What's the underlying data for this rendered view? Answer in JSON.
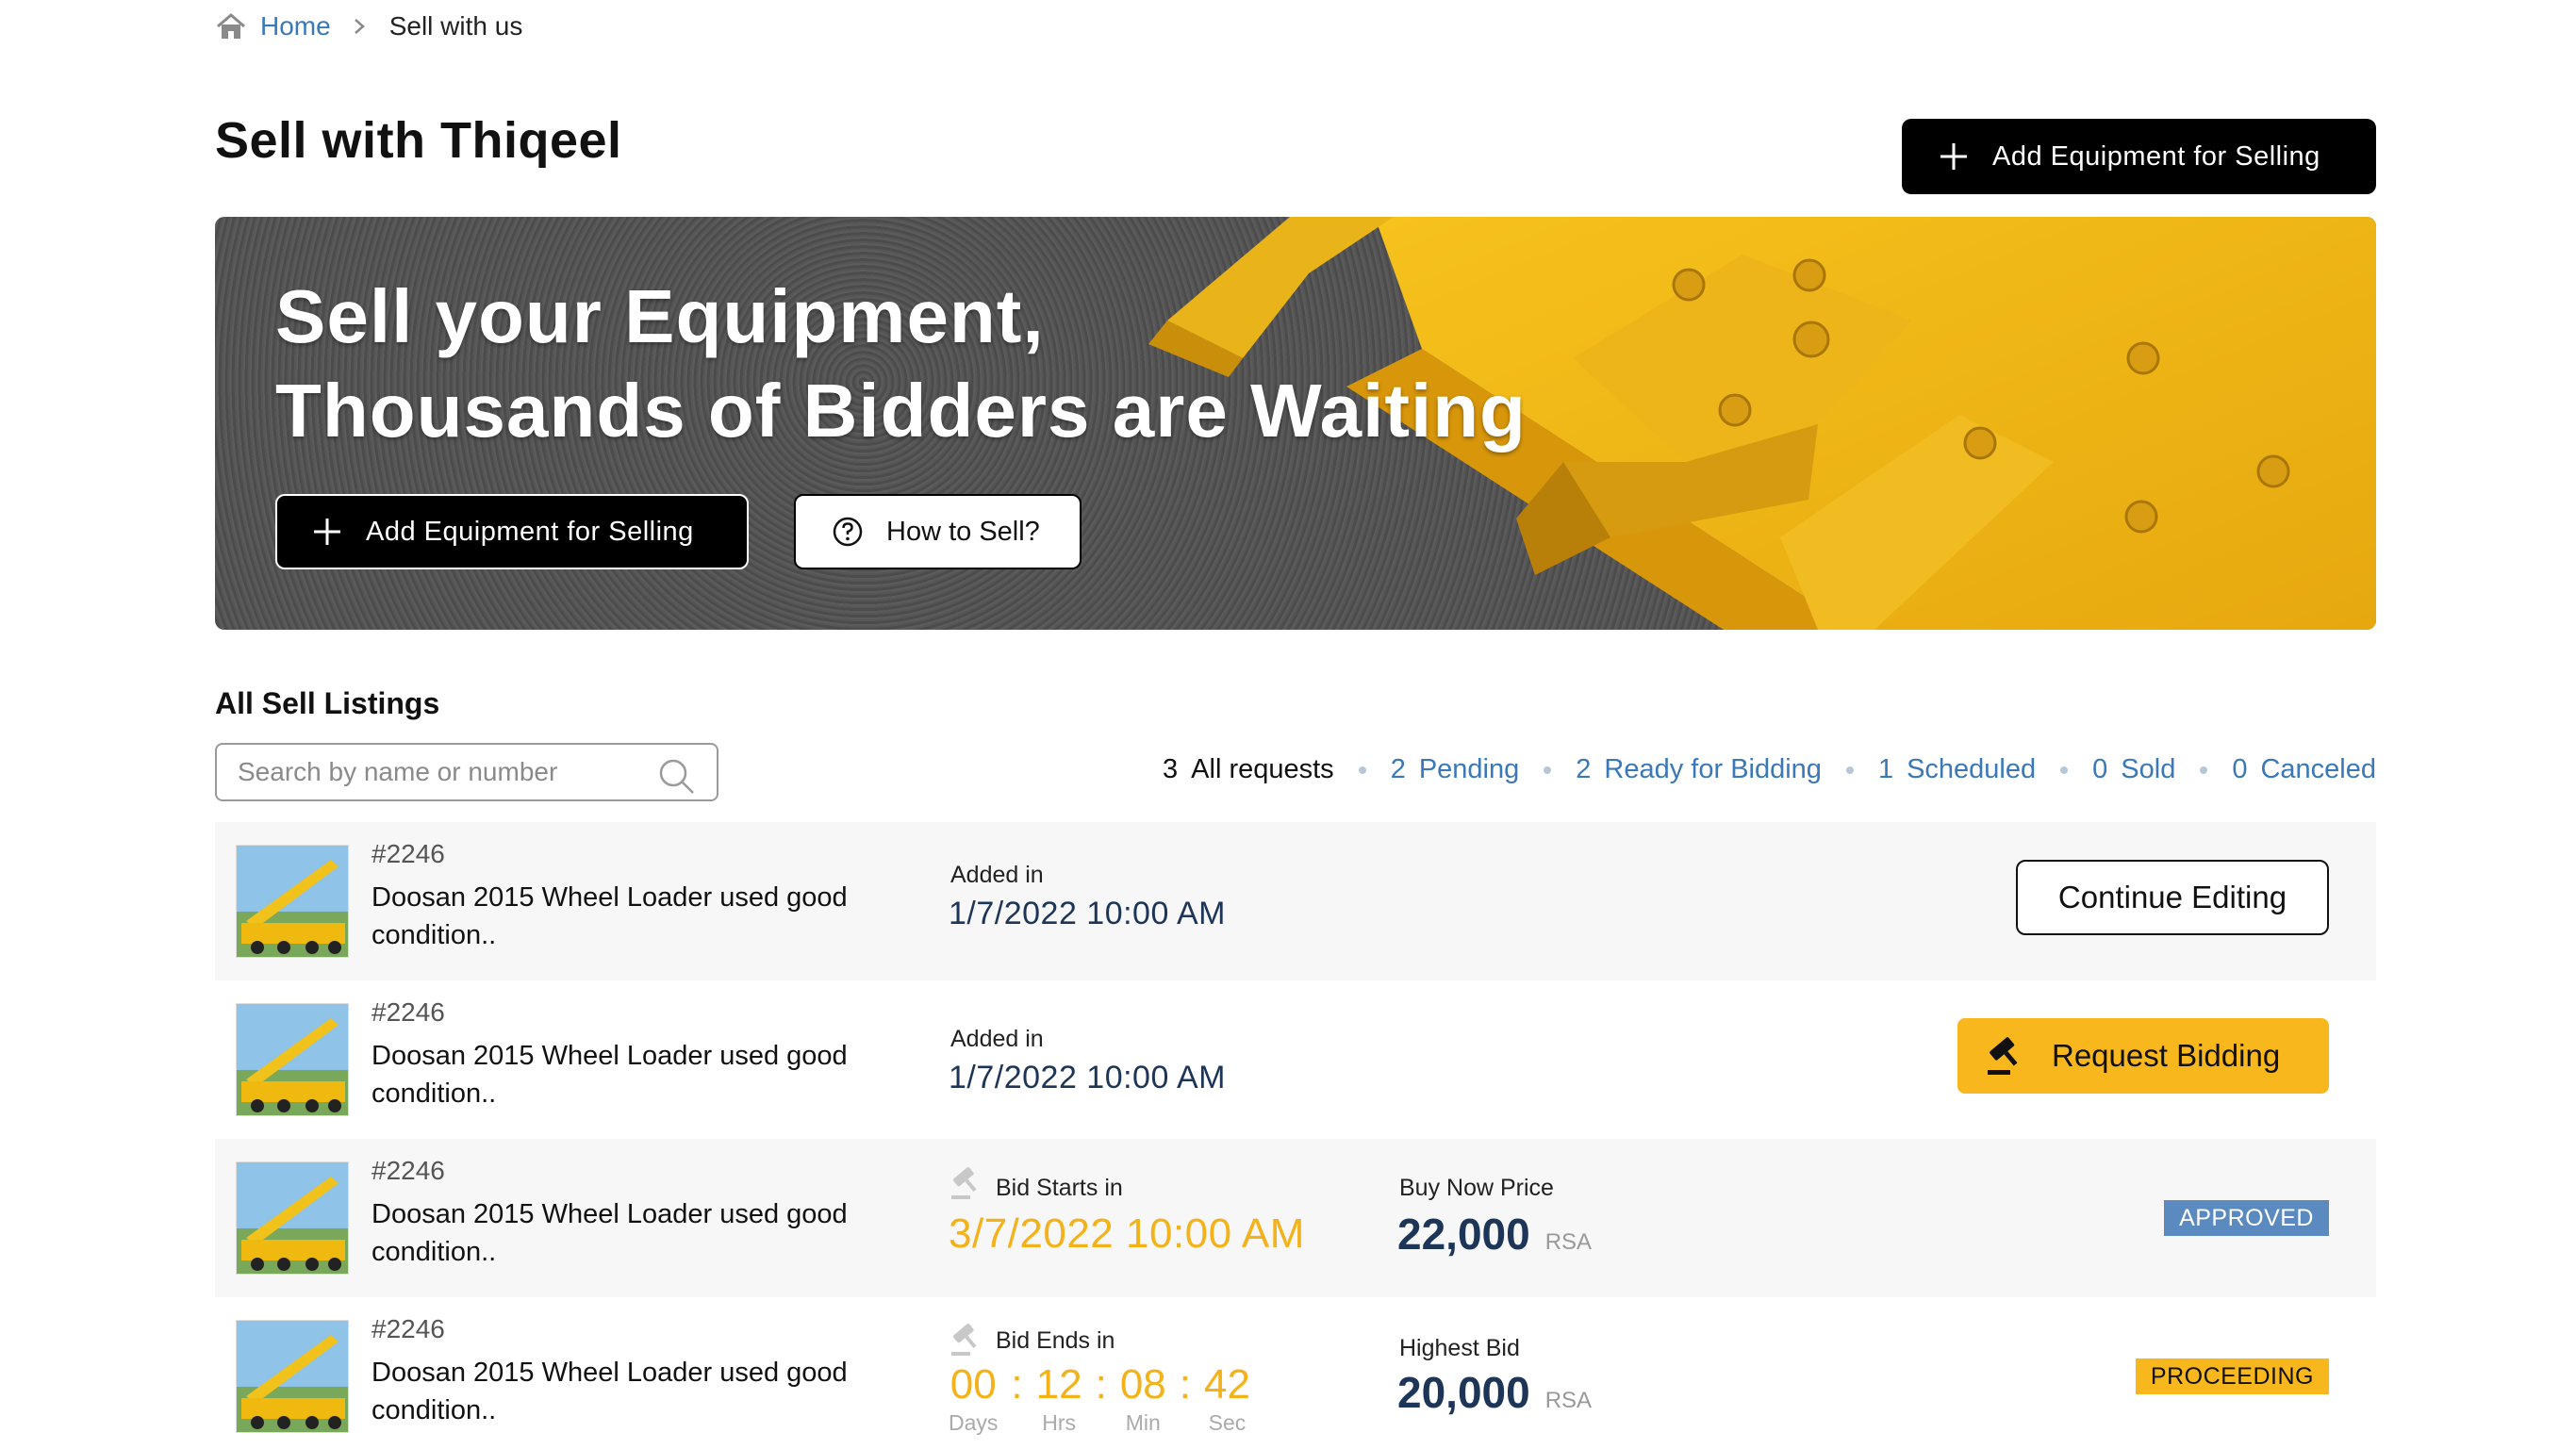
{
  "breadcrumb": {
    "home": "Home",
    "current": "Sell with us"
  },
  "page": {
    "title": "Sell with Thiqeel",
    "add_button": "Add Equipment for Selling"
  },
  "hero": {
    "title_line1": "Sell your Equipment,",
    "title_line2": "Thousands of Bidders are Waiting",
    "add_button": "Add Equipment for Selling",
    "how_button": "How to Sell?"
  },
  "listings": {
    "title": "All Sell Listings",
    "search_placeholder": "Search by name or number",
    "filters": [
      {
        "count": "3",
        "label": "All requests"
      },
      {
        "count": "2",
        "label": "Pending"
      },
      {
        "count": "2",
        "label": "Ready for Bidding"
      },
      {
        "count": "1",
        "label": "Scheduled"
      },
      {
        "count": "0",
        "label": "Sold"
      },
      {
        "count": "0",
        "label": "Canceled"
      }
    ],
    "rows": [
      {
        "id": "#2246",
        "name": "Doosan 2015 Wheel Loader used good condition..",
        "date_label": "Added in",
        "date": "1/7/2022 10:00 AM",
        "action": "Continue Editing"
      },
      {
        "id": "#2246",
        "name": "Doosan 2015 Wheel Loader used good condition..",
        "date_label": "Added in",
        "date": "1/7/2022 10:00 AM",
        "action": "Request Bidding"
      },
      {
        "id": "#2246",
        "name": "Doosan 2015 Wheel Loader used good condition..",
        "date_label": "Bid Starts in",
        "date": "3/7/2022 10:00 AM",
        "price_label": "Buy Now Price",
        "price": "22,000",
        "currency": "RSA",
        "status": "APPROVED"
      },
      {
        "id": "#2246",
        "name": "Doosan 2015 Wheel Loader used good condition..",
        "date_label": "Bid Ends in",
        "countdown": {
          "days": "00",
          "hrs": "12",
          "min": "08",
          "sec": "42",
          "days_label": "Days",
          "hrs_label": "Hrs",
          "min_label": "Min",
          "sec_label": "Sec"
        },
        "price_label": "Highest Bid",
        "price": "20,000",
        "currency": "RSA",
        "status": "PROCEEDING"
      }
    ]
  },
  "colors": {
    "accent_blue": "#3a78b8",
    "navy": "#1d3557",
    "yellow": "#f8b71c",
    "approved": "#5b8ac0"
  },
  "icons": [
    "home-icon",
    "chevron-right-icon",
    "plus-icon",
    "question-circle-icon",
    "search-icon",
    "gavel-icon"
  ]
}
